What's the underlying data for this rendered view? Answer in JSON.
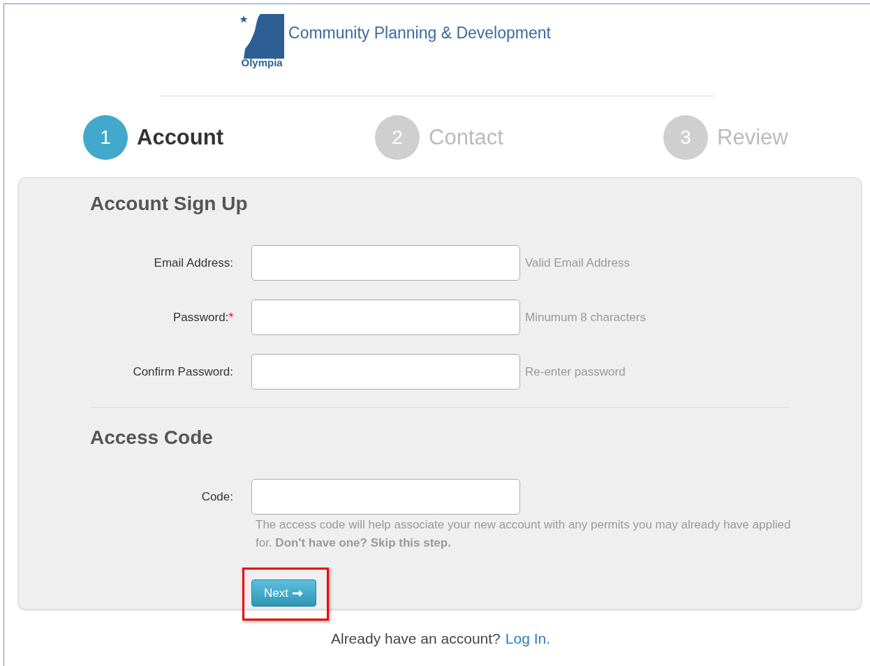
{
  "logo": {
    "wordmark": "Olympia",
    "title": "Community Planning & Development"
  },
  "steps": [
    {
      "number": "1",
      "label": "Account",
      "selected": true
    },
    {
      "number": "2",
      "label": "Contact",
      "selected": false
    },
    {
      "number": "3",
      "label": "Review",
      "selected": false
    }
  ],
  "sections": [
    {
      "title": "Account Sign Up",
      "fields": [
        {
          "label": "Email Address:",
          "required": false,
          "hint": "Valid Email Address"
        },
        {
          "label": "Password:",
          "required": true,
          "hint": "Minumum 8 characters"
        },
        {
          "label": "Confirm Password:",
          "required": false,
          "hint": "Re-enter password"
        }
      ]
    },
    {
      "title": "Access Code",
      "fields": [
        {
          "label": "Code:",
          "required": false
        }
      ],
      "note": "The access code will help associate your new account with any permits you may already have applied for. **Don't have one? Skip this step.**"
    }
  ],
  "required_mark": "*",
  "next_button": {
    "label": "Next",
    "highlighted": true
  },
  "footer": {
    "text": "Already have an account?",
    "link": "Log In."
  }
}
